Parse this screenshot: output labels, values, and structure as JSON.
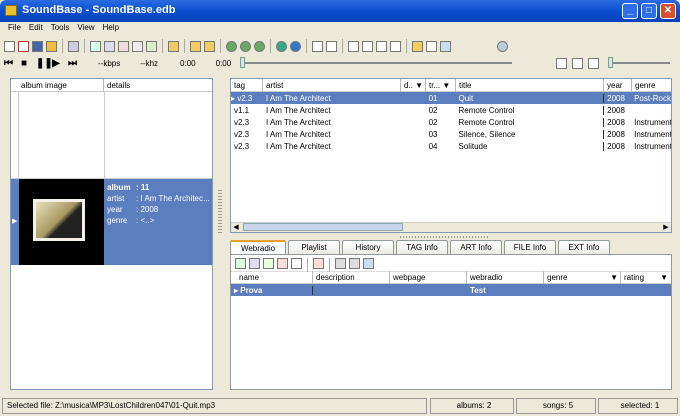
{
  "window": {
    "title": "SoundBase - SoundBase.edb"
  },
  "menu": [
    "File",
    "Edit",
    "Tools",
    "View",
    "Help"
  ],
  "player": {
    "kbps": "--kbps",
    "khz": "--khz",
    "elapsed": "0:00",
    "total": "0:00"
  },
  "albums": {
    "headers": [
      "album image",
      "details"
    ],
    "selected": {
      "album_label": "album",
      "album": ": 11",
      "artist_label": "artist",
      "artist": ": I Am The Architec...",
      "year_label": "year",
      "year": ": 2008",
      "genre_label": "genre",
      "genre": ": <..>"
    }
  },
  "songs": {
    "headers": [
      "tag",
      "artist",
      "d..",
      "tr...",
      "title",
      "year",
      "genre"
    ],
    "rows": [
      {
        "tag": "v2.3",
        "artist": "I Am The Architect",
        "track": "01",
        "title": "Quit",
        "year": "2008",
        "genre": "Post-Rock"
      },
      {
        "tag": "v1.1",
        "artist": "I Am The Architect",
        "track": "02",
        "title": "Remote Control",
        "year": "2008",
        "genre": ""
      },
      {
        "tag": "v2.3",
        "artist": "I Am The Architect",
        "track": "02",
        "title": "Remote Control",
        "year": "2008",
        "genre": "Instrumental"
      },
      {
        "tag": "v2.3",
        "artist": "I Am The Architect",
        "track": "03",
        "title": "Silence, Silence",
        "year": "2008",
        "genre": "Instrumental"
      },
      {
        "tag": "v2.3",
        "artist": "I Am The Architect",
        "track": "04",
        "title": "Solitude",
        "year": "2008",
        "genre": "Instrumental"
      }
    ]
  },
  "tabs": [
    "Webradio",
    "Playlist",
    "History",
    "TAG Info",
    "ART Info",
    "FILE Info",
    "EXT Info"
  ],
  "webradio": {
    "headers": [
      "name",
      "description",
      "webpage",
      "webradio",
      "genre",
      "rating"
    ],
    "rows": [
      {
        "name": "Prova",
        "description": "",
        "webpage": "",
        "webradio": "Test",
        "genre": "",
        "rating": ""
      }
    ]
  },
  "status": {
    "file": "Selected file: Z:\\musica\\MP3\\LostChildren047\\01-Quit.mp3",
    "albums": "albums: 2",
    "songs": "songs: 5",
    "selected": "selected: 1"
  }
}
